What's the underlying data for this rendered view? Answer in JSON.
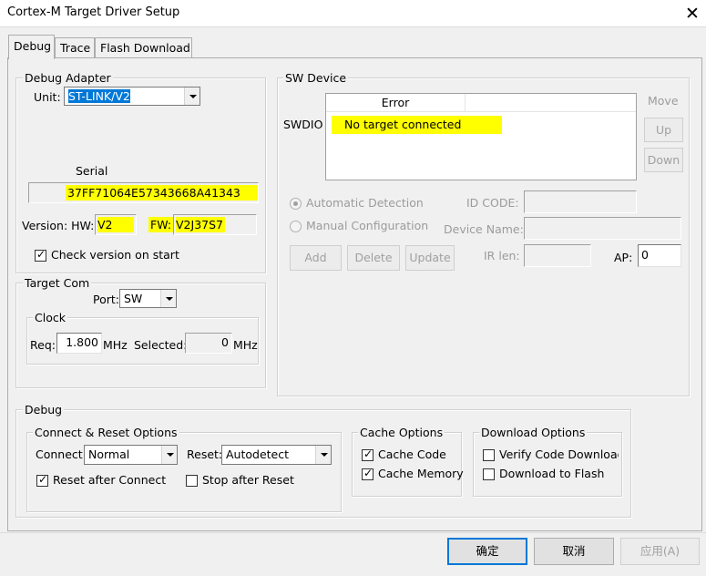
{
  "window": {
    "title": "Cortex-M Target Driver Setup",
    "close": "✕"
  },
  "tabs": [
    {
      "label": "Debug",
      "active": true
    },
    {
      "label": "Trace",
      "active": false
    },
    {
      "label": "Flash Download",
      "active": false
    }
  ],
  "debug_adapter": {
    "title": "Debug Adapter",
    "unit_label": "Unit:",
    "unit_value": "ST-LINK/V2",
    "serial_label": "Serial",
    "serial_value": "37FF71064E57343668A41343",
    "version_label": "Version: HW:",
    "hw_value": "V2",
    "fw_label": "FW:",
    "fw_value": "V2J37S7",
    "check_version_label": "Check version on start",
    "check_version_checked": true
  },
  "target_com": {
    "title": "Target Com",
    "port_label": "Port:",
    "port_value": "SW",
    "clock_title": "Clock",
    "req_label": "Req:",
    "req_value": "1.800",
    "req_unit": "MHz",
    "selected_label": "Selected:",
    "selected_value": "0",
    "selected_unit": "MHz"
  },
  "sw_device": {
    "title": "SW Device",
    "swdio_label": "SWDIO",
    "columns": [
      "Error",
      ""
    ],
    "rows": [
      {
        "error": "No target connected"
      }
    ],
    "move_label": "Move",
    "up_label": "Up",
    "down_label": "Down",
    "auto_detection_label": "Automatic Detection",
    "manual_config_label": "Manual Configuration",
    "id_code_label": "ID CODE:",
    "device_name_label": "Device Name:",
    "ir_len_label": "IR len:",
    "ap_label": "AP:",
    "ap_value": "0",
    "add_label": "Add",
    "delete_label": "Delete",
    "update_label": "Update"
  },
  "debug": {
    "title": "Debug",
    "connect_reset": {
      "title": "Connect & Reset Options",
      "connect_label": "Connect:",
      "connect_value": "Normal",
      "reset_label": "Reset:",
      "reset_value": "Autodetect",
      "reset_after_connect_label": "Reset after Connect",
      "reset_after_connect_checked": true,
      "stop_after_reset_label": "Stop after Reset",
      "stop_after_reset_checked": false
    },
    "cache": {
      "title": "Cache Options",
      "cache_code_label": "Cache Code",
      "cache_code_checked": true,
      "cache_memory_label": "Cache Memory",
      "cache_memory_checked": true
    },
    "download": {
      "title": "Download Options",
      "verify_label": "Verify Code Download",
      "verify_checked": false,
      "download_flash_label": "Download to Flash",
      "download_flash_checked": false
    }
  },
  "buttons": {
    "ok": "确定",
    "cancel": "取消",
    "apply": "应用(A)"
  },
  "colors": {
    "highlight": "#ffff00",
    "selection": "#0078d7",
    "default_button_border": "#0078d7"
  }
}
